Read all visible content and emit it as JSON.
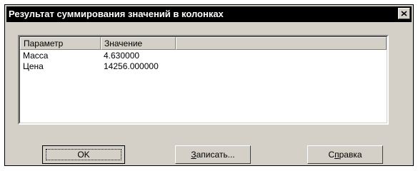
{
  "window": {
    "title": "Результат суммирования значений в колонках",
    "close_icon": "close-icon"
  },
  "table": {
    "columns": [
      "Параметр",
      "Значение"
    ],
    "rows": [
      {
        "param": "Масса",
        "value": "4.630000"
      },
      {
        "param": "Цена",
        "value": "14256.000000"
      }
    ]
  },
  "buttons": {
    "ok": "OK",
    "save_mnemonic": "З",
    "save_rest": "аписать...",
    "help_pre": "С",
    "help_mnemonic": "п",
    "help_rest": "равка"
  }
}
